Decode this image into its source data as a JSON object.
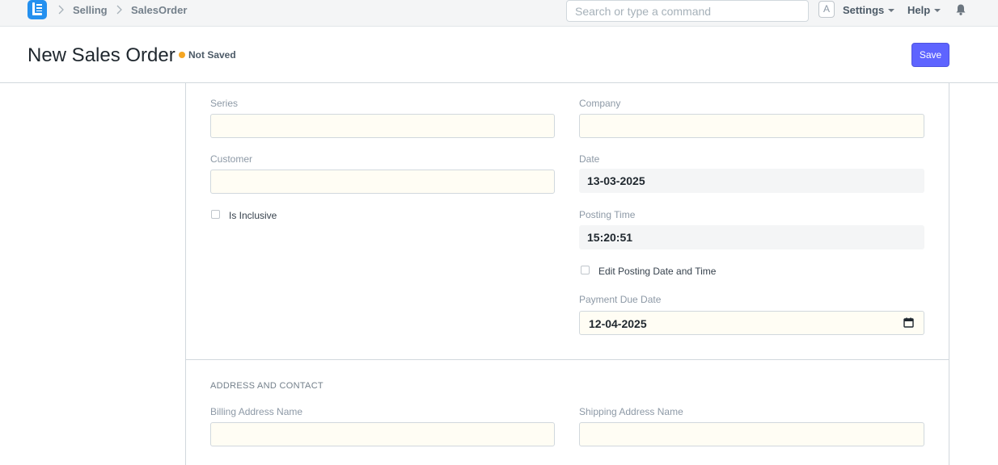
{
  "navbar": {
    "logo_icon": "app-logo-icon",
    "breadcrumbs": [
      "Selling",
      "SalesOrder"
    ],
    "search_placeholder": "Search or type a command",
    "avatar_letter": "A",
    "settings_label": "Settings",
    "help_label": "Help",
    "notification_icon": "bell-icon"
  },
  "page": {
    "title": "New Sales Order",
    "status": "Not Saved",
    "status_color": "#f5a623",
    "save_label": "Save",
    "accent_color": "#5e64ff"
  },
  "form": {
    "series": {
      "label": "Series",
      "value": ""
    },
    "company": {
      "label": "Company",
      "value": ""
    },
    "customer": {
      "label": "Customer",
      "value": ""
    },
    "date": {
      "label": "Date",
      "value": "13-03-2025"
    },
    "is_inclusive": {
      "label": "Is Inclusive",
      "checked": false
    },
    "posting_time": {
      "label": "Posting Time",
      "value": "15:20:51"
    },
    "edit_posting": {
      "label": "Edit Posting Date and Time",
      "checked": false
    },
    "payment_due_date": {
      "label": "Payment Due Date",
      "value": "12-04-2025"
    }
  },
  "address_section": {
    "title": "ADDRESS AND CONTACT",
    "billing_address": {
      "label": "Billing Address Name",
      "value": ""
    },
    "shipping_address": {
      "label": "Shipping Address Name",
      "value": ""
    }
  }
}
